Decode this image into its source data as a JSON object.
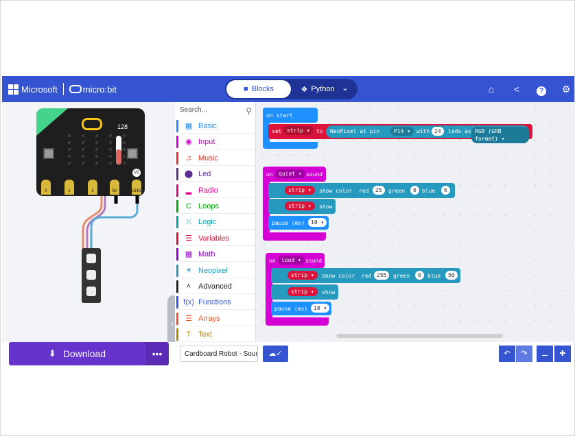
{
  "header": {
    "brand_microsoft": "Microsoft",
    "brand_microbit": "micro:bit",
    "tab_blocks": "Blocks",
    "tab_python": "Python",
    "icons": [
      "home-icon",
      "share-icon",
      "help-icon",
      "settings-icon"
    ]
  },
  "simulator": {
    "temperature": "128",
    "version_badge": "V2",
    "pins": [
      "0",
      "1",
      "2",
      "3V",
      "GND"
    ]
  },
  "toolbox": {
    "search_placeholder": "Search...",
    "categories": [
      {
        "label": "Basic",
        "color": "#1e90ff"
      },
      {
        "label": "Input",
        "color": "#d400d4"
      },
      {
        "label": "Music",
        "color": "#e63022"
      },
      {
        "label": "Led",
        "color": "#5c2d91"
      },
      {
        "label": "Radio",
        "color": "#e3008c"
      },
      {
        "label": "Loops",
        "color": "#00aa00"
      },
      {
        "label": "Logic",
        "color": "#00a4a6"
      },
      {
        "label": "Variables",
        "color": "#dc143c"
      },
      {
        "label": "Math",
        "color": "#9400d3"
      },
      {
        "label": "Neopixel",
        "color": "#2699bf"
      },
      {
        "label": "Advanced",
        "color": "#222222"
      },
      {
        "label": "Functions",
        "color": "#3455db"
      },
      {
        "label": "Arrays",
        "color": "#e65722"
      },
      {
        "label": "Text",
        "color": "#b8860b"
      }
    ]
  },
  "blocks": {
    "on_start": {
      "title": "on start",
      "set": "set",
      "var": "strip",
      "to": "to",
      "neopixel": "NeoPixel at pin",
      "pin": "P14",
      "with": "with",
      "count": "24",
      "leds_as": "leds as",
      "format": "RGB (GRB format)"
    },
    "quiet": {
      "on": "on",
      "level": "quiet",
      "sound": "sound",
      "var": "strip",
      "show_color": "show color",
      "red": "red",
      "red_val": "25",
      "green": "green",
      "green_val": "0",
      "blue": "blue",
      "blue_val": "6",
      "show": "show",
      "pause": "pause (ms)",
      "pause_val": "10"
    },
    "loud": {
      "on": "on",
      "level": "loud",
      "sound": "sound",
      "var": "strip",
      "show_color": "show color",
      "red": "red",
      "red_val": "255",
      "green": "green",
      "green_val": "0",
      "blue": "blue",
      "blue_val": "50",
      "show": "show",
      "pause": "pause (ms)",
      "pause_val": "10"
    }
  },
  "bottom": {
    "download": "Download",
    "more": "•••",
    "project_name": "Cardboard Robot - Sound"
  },
  "colors": {
    "header": "#3454d1",
    "download": "#6633cc",
    "event_block": "#d400d4",
    "neopixel_block": "#2699bf",
    "variable_block": "#dc143c",
    "basic_block": "#1e90ff"
  }
}
